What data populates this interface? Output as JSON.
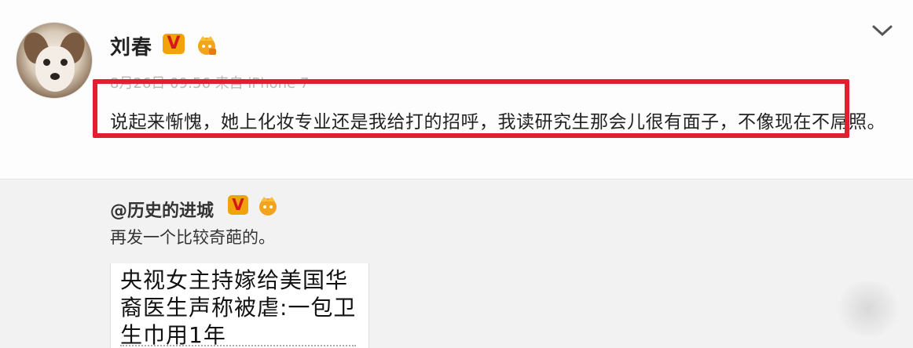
{
  "post": {
    "username": "刘春",
    "verified_badge": "V",
    "meta_text": "8月26日 09:56 来自 iPhone 7",
    "text": "说起来惭愧，她上化妆专业还是我给打的招呼，我读研究生那会儿很有面子，不像现在不屌照。",
    "icons": {
      "avatar": "dog-avatar",
      "more": "chevron-down-icon",
      "level": "crown-level-icon"
    }
  },
  "repost": {
    "username": "@历史的进城",
    "verified_badge": "V",
    "text": "再发一个比较奇葩的。",
    "article_title": "央视女主持嫁给美国华裔医生声称被虐:一包卫生巾用1年"
  },
  "colors": {
    "highlight": "#e0202e",
    "verified_bg": "#f0a30a",
    "verified_fg": "#d41818"
  }
}
